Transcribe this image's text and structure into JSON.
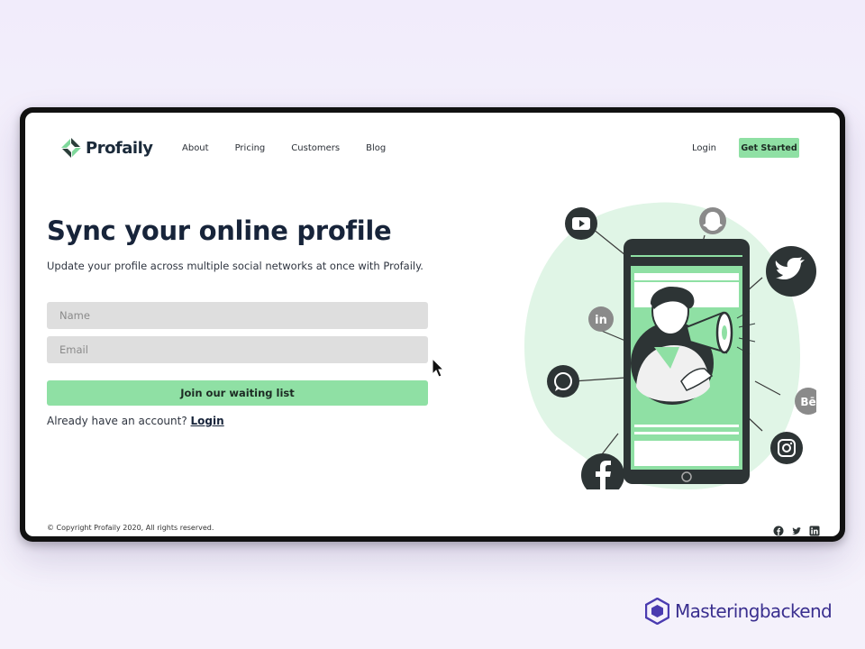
{
  "nav": {
    "brand": "Profaily",
    "links": [
      "About",
      "Pricing",
      "Customers",
      "Blog"
    ],
    "login": "Login",
    "cta": "Get Started"
  },
  "hero": {
    "headline": "Sync your online profile",
    "subtext": "Update your profile across multiple social networks at once with Profaily.",
    "name_placeholder": "Name",
    "email_placeholder": "Email",
    "submit": "Join our waiting list",
    "account_text": "Already have an account?",
    "account_link": "Login"
  },
  "footer": {
    "copyright": "© Copyright Profaily 2020, All rights reserved.",
    "social_icons": [
      "facebook-icon",
      "twitter-icon",
      "linkedin-icon"
    ]
  },
  "illustration": {
    "icons": [
      "youtube-icon",
      "snapchat-icon",
      "twitter-icon",
      "linkedin-icon",
      "behance-icon",
      "whatsapp-icon",
      "instagram-icon",
      "facebook-icon"
    ],
    "behance_label": "Bē",
    "linkedin_label": "in"
  },
  "watermark": {
    "text": "Masteringbackend"
  },
  "colors": {
    "accent": "#8fe0a4",
    "navy": "#17243a",
    "blob": "#e0f5e6",
    "brand": "#3a2f8f"
  }
}
